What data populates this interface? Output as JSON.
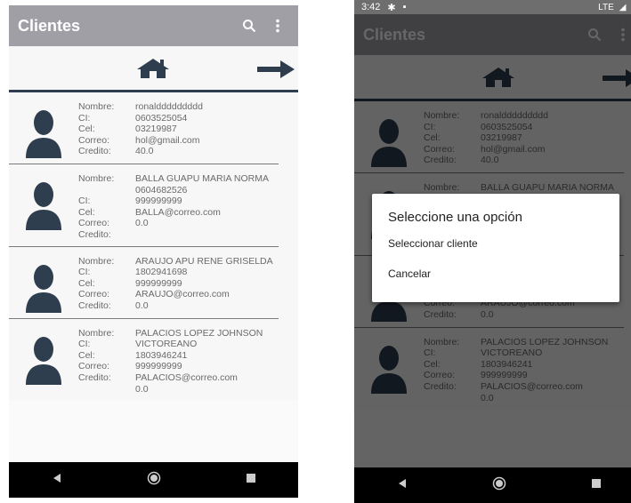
{
  "app": {
    "title": "Clientes",
    "search_icon": "search-icon",
    "menu_icon": "more-vert-icon"
  },
  "status": {
    "time": "3:42",
    "signal": "LTE"
  },
  "labels": [
    "Nombre:",
    "CI:",
    "Cel:",
    "Correo:",
    "Credito:"
  ],
  "clients": [
    {
      "nombre": "ronalddddddddd",
      "ci": "0603525054",
      "cel": "03219987",
      "correo": "hol@gmail.com",
      "credito": "40.0"
    },
    {
      "nombre": "BALLA GUAPU MARIA NORMA",
      "ci": "0604682526",
      "cel": "999999999",
      "correo": "BALLA@correo.com",
      "credito": "0.0"
    },
    {
      "nombre": "ARAUJO APU RENE GRISELDA",
      "ci": "1802941698",
      "cel": "999999999",
      "correo": "ARAUJO@correo.com",
      "credito": "0.0"
    },
    {
      "nombre": "PALACIOS LOPEZ JOHNSON VICTOREANO",
      "ci": "1803946241",
      "cel": "999999999",
      "correo": "PALACIOS@correo.com",
      "credito": "0.0"
    }
  ],
  "dialog": {
    "title": "Seleccione una opción",
    "option_select": "Seleccionar cliente",
    "option_cancel": "Cancelar"
  },
  "colors": {
    "appbar": "#a09fa5",
    "divider": "#2f3e4e",
    "avatar": "#2f3e4e"
  }
}
